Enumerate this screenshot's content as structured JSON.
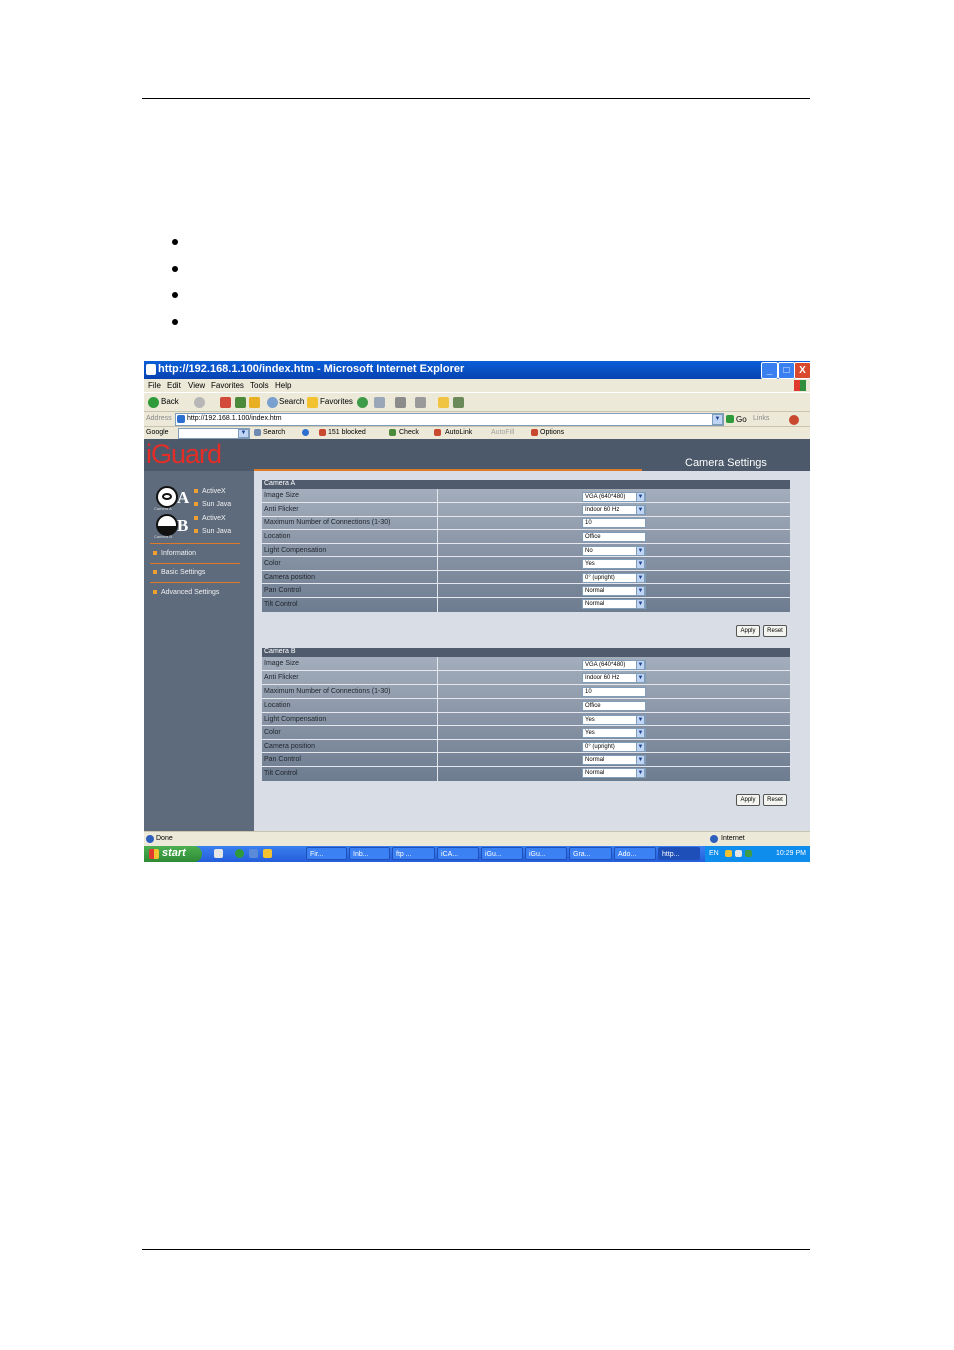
{
  "window": {
    "title": "http://192.168.1.100/index.htm - Microsoft Internet Explorer",
    "minimize": "_",
    "maximize": "□",
    "close": "X"
  },
  "menubar": [
    "File",
    "Edit",
    "View",
    "Favorites",
    "Tools",
    "Help"
  ],
  "toolbar": {
    "back": "Back",
    "search": "Search",
    "favorites": "Favorites"
  },
  "address": {
    "label": "Address",
    "url": "http://192.168.1.100/index.htm",
    "go": "Go",
    "links": "Links"
  },
  "googlebar": {
    "brand": "Google",
    "search": "Search",
    "blocked": "151 blocked",
    "check": "Check",
    "autolink": "AutoLink",
    "autofill": "AutoFill",
    "options": "Options"
  },
  "page": {
    "logo": "iGuard",
    "section_title": "Camera Settings",
    "nav": {
      "camera_a_letter": "A",
      "camera_b_letter": "B",
      "camera_a_tiny": "Camera A",
      "camera_b_tiny": "Camera B",
      "a_activex": "ActiveX",
      "a_java": "Sun Java",
      "b_activex": "ActiveX",
      "b_java": "Sun Java",
      "information": "Information",
      "basic_settings": "Basic Settings",
      "advanced_settings": "Advanced Settings"
    },
    "camera_a": {
      "header": "Camera A",
      "rows": [
        {
          "label": "Image Size",
          "value": "VGA (640*480)"
        },
        {
          "label": "Anti Flicker",
          "value": "Indoor 60 Hz"
        },
        {
          "label": "Maximum Number of Connections (1-30)",
          "value": "10"
        },
        {
          "label": "Location",
          "value": "Office"
        },
        {
          "label": "Light Compensation",
          "value": "No"
        },
        {
          "label": "Color",
          "value": "Yes"
        },
        {
          "label": "Camera position",
          "value": "0° (upright)"
        },
        {
          "label": "Pan Control",
          "value": "Normal"
        },
        {
          "label": "Tilt Control",
          "value": "Normal"
        }
      ],
      "apply": "Apply",
      "reset": "Reset"
    },
    "camera_b": {
      "header": "Camera B",
      "rows": [
        {
          "label": "Image Size",
          "value": "VGA (640*480)"
        },
        {
          "label": "Anti Flicker",
          "value": "Indoor 60 Hz"
        },
        {
          "label": "Maximum Number of Connections (1-30)",
          "value": "10"
        },
        {
          "label": "Location",
          "value": "Office"
        },
        {
          "label": "Light Compensation",
          "value": "Yes"
        },
        {
          "label": "Color",
          "value": "Yes"
        },
        {
          "label": "Camera position",
          "value": "0° (upright)"
        },
        {
          "label": "Pan Control",
          "value": "Normal"
        },
        {
          "label": "Tilt Control",
          "value": "Normal"
        }
      ],
      "apply": "Apply",
      "reset": "Reset"
    }
  },
  "status": {
    "done": "Done",
    "zone": "Internet"
  },
  "taskbar": {
    "start": "start",
    "buttons": [
      "Fir...",
      "Inb...",
      "ftp ...",
      "iCA...",
      "iGu...",
      "iGu...",
      "Gra...",
      "Ado...",
      "http..."
    ],
    "lang": "EN",
    "clock": "10:29 PM"
  },
  "colors": {
    "header": "#4c596a",
    "nav": "#5e6b7d",
    "accent": "#e07a28",
    "logo": "#e42d27"
  }
}
